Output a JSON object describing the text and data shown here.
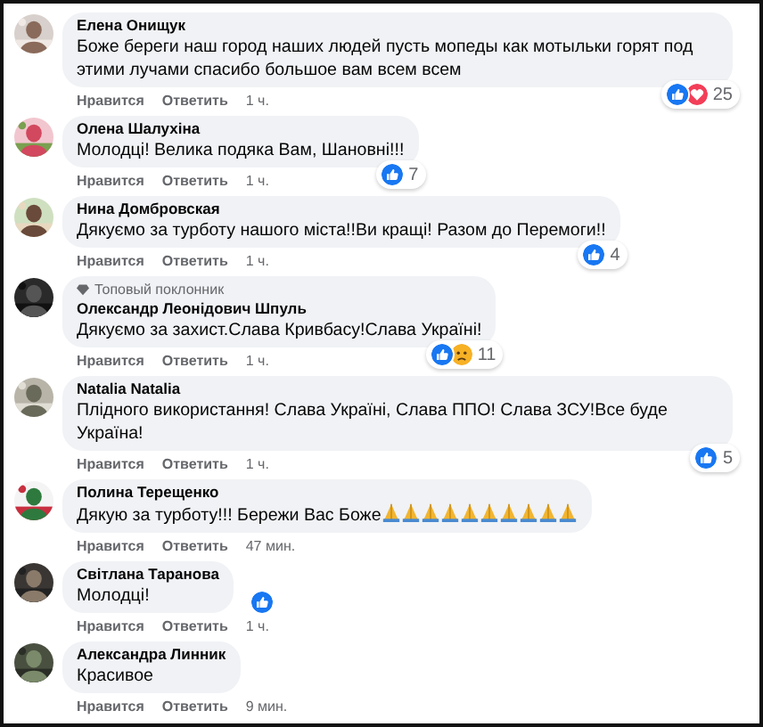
{
  "comments": [
    {
      "author": "Елена Онищук",
      "text": "Боже береги наш город наших людей пусть мопеды как мотыльки горят под этими лучами спасибо большое вам всем всем",
      "reactions": [
        {
          "kind": "like"
        },
        {
          "kind": "love"
        }
      ],
      "reaction_count": "25",
      "actions": [
        "Нравится",
        "Ответить"
      ],
      "time": "1 ч."
    },
    {
      "author": "Олена Шалухіна",
      "text": "Молодці! Велика подяка Вам, Шановні!!!",
      "reactions": [
        {
          "kind": "like"
        }
      ],
      "reaction_count": "7",
      "actions": [
        "Нравится",
        "Ответить"
      ],
      "time": "1 ч."
    },
    {
      "author": "Нина Домбровская",
      "text": "Дякуємо за турботу нашого міста!!Ви кращі! Разом до Перемоги!!",
      "reactions": [
        {
          "kind": "like"
        }
      ],
      "reaction_count": "4",
      "actions": [
        "Нравится",
        "Ответить"
      ],
      "time": "1 ч."
    },
    {
      "author": "Олександр Леонідович Шпуль",
      "badge": "Топовый поклонник",
      "text": "Дякуємо за захист.Слава Кривбасу!Слава Україні!",
      "reactions": [
        {
          "kind": "like"
        },
        {
          "kind": "sad"
        }
      ],
      "reaction_count": "11",
      "actions": [
        "Нравится",
        "Ответить"
      ],
      "time": "1 ч."
    },
    {
      "author": "Natalia Natalia",
      "text": "Плідного використання! Слава Україні, Слава ППО! Слава ЗСУ!Все буде Україна!",
      "reactions": [
        {
          "kind": "like"
        }
      ],
      "reaction_count": "5",
      "actions": [
        "Нравится",
        "Ответить"
      ],
      "time": "1 ч."
    },
    {
      "author": "Полина Терещенко",
      "text": "Дякую за турботу!!! Бережи Вас Боже",
      "emojis": [
        {
          "kind": "pray"
        },
        {
          "kind": "pray"
        },
        {
          "kind": "pray"
        },
        {
          "kind": "pray"
        },
        {
          "kind": "pray"
        },
        {
          "kind": "pray"
        },
        {
          "kind": "pray"
        },
        {
          "kind": "pray"
        },
        {
          "kind": "pray"
        },
        {
          "kind": "pray"
        }
      ],
      "actions": [
        "Нравится",
        "Ответить"
      ],
      "time": "47 мин."
    },
    {
      "author": "Світлана Таранова",
      "text": "Молодці!",
      "reactions": [
        {
          "kind": "like"
        }
      ],
      "actions": [
        "Нравится",
        "Ответить"
      ],
      "time": "1 ч."
    },
    {
      "author": "Александра Линник",
      "text": "Красивое",
      "actions": [
        "Нравится",
        "Ответить"
      ],
      "time": "9 мин."
    }
  ]
}
